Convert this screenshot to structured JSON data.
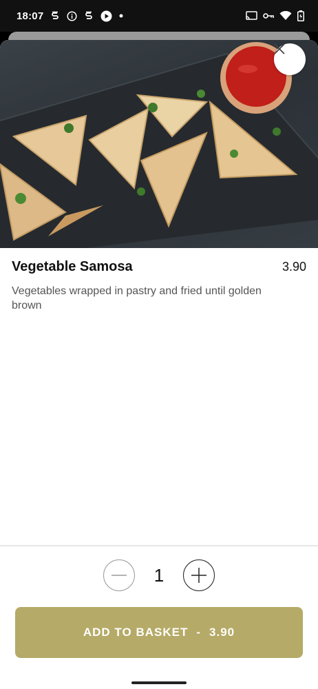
{
  "status_bar": {
    "time": "18:07",
    "left_icons": [
      "s-app-icon",
      "info-icon",
      "s-app-icon",
      "play-icon",
      "dot-icon"
    ],
    "right_icons": [
      "cast-icon",
      "vpn-key-icon",
      "wifi-icon",
      "battery-icon"
    ]
  },
  "item": {
    "name": "Vegetable Samosa",
    "price": "3.90",
    "description": "Vegetables wrapped in pastry and fried until golden brown",
    "image_alt": "Vegetable samosas on slate board with ketchup"
  },
  "quantity": {
    "value": "1"
  },
  "add_button": {
    "label": "ADD TO BASKET",
    "separator": "-",
    "price": "3.90"
  },
  "colors": {
    "accent": "#b5aa67",
    "text": "#111111",
    "muted": "#555555"
  }
}
